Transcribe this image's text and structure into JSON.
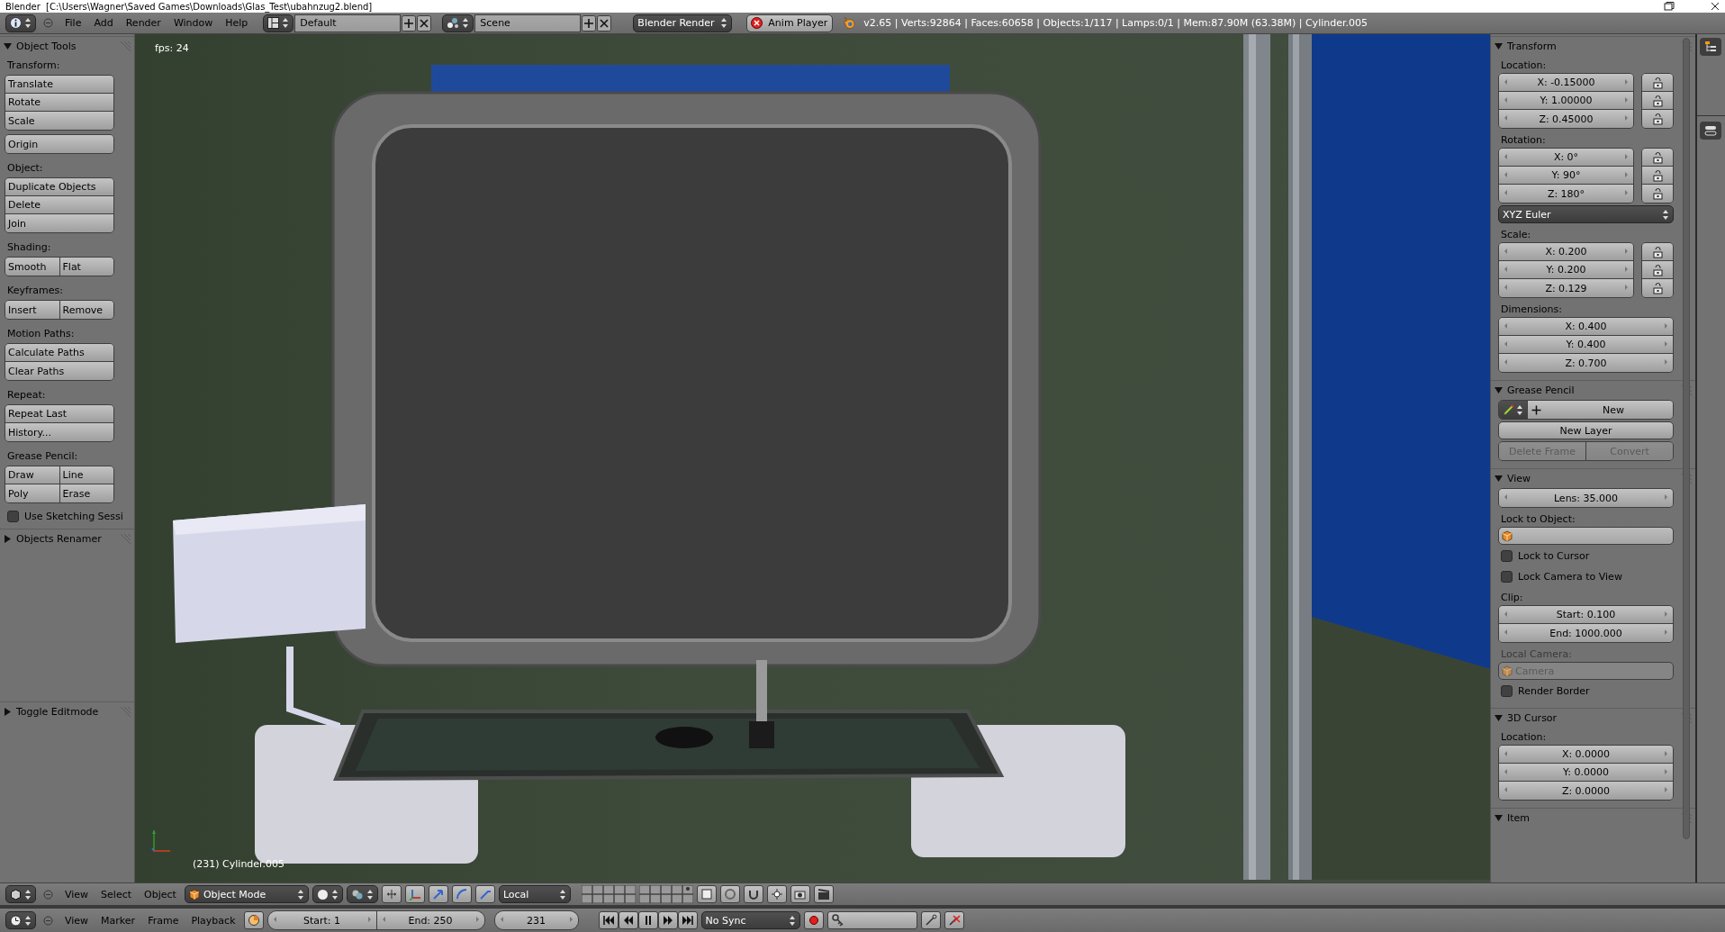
{
  "title_bar": {
    "text": "Blender  [C:\\Users\\Wagner\\Saved Games\\Downloads\\Glas_Test\\ubahnzug2.blend]"
  },
  "info_header": {
    "menus": [
      "File",
      "Add",
      "Render",
      "Window",
      "Help"
    ],
    "layout": "Default",
    "scene": "Scene",
    "engine": "Blender Render",
    "anim_player": "Anim Player",
    "stats": "v2.65 | Verts:92864 | Faces:60658 | Objects:1/117 | Lamps:0/1 | Mem:87.90M (63.38M) | Cylinder.005"
  },
  "tool_shelf": {
    "panels": [
      {
        "title": "Object Tools",
        "expanded": true,
        "sections": [
          {
            "label": "Transform:",
            "groups": [
              [
                [
                  "Translate"
                ],
                [
                  "Rotate"
                ],
                [
                  "Scale"
                ]
              ],
              [
                [
                  "Origin"
                ]
              ]
            ]
          },
          {
            "label": "Object:",
            "groups": [
              [
                [
                  "Duplicate Objects"
                ],
                [
                  "Delete"
                ],
                [
                  "Join"
                ]
              ]
            ]
          },
          {
            "label": "Shading:",
            "groups": [
              [
                [
                  "Smooth",
                  "Flat"
                ]
              ]
            ]
          },
          {
            "label": "Keyframes:",
            "groups": [
              [
                [
                  "Insert",
                  "Remove"
                ]
              ]
            ]
          },
          {
            "label": "Motion Paths:",
            "groups": [
              [
                [
                  "Calculate Paths"
                ],
                [
                  "Clear Paths"
                ]
              ]
            ]
          },
          {
            "label": "Repeat:",
            "groups": [
              [
                [
                  "Repeat Last"
                ],
                [
                  "History..."
                ]
              ]
            ]
          },
          {
            "label": "Grease Pencil:",
            "groups": [
              [
                [
                  "Draw",
                  "Line"
                ],
                [
                  "Poly",
                  "Erase"
                ]
              ]
            ],
            "checkbox": {
              "label": "Use Sketching Sessi",
              "checked": false
            }
          }
        ]
      },
      {
        "title": "Objects Renamer",
        "expanded": false
      },
      {
        "title": "Toggle Editmode",
        "expanded": false
      }
    ]
  },
  "viewport": {
    "fps": "fps: 24",
    "object_info": "(231) Cylinder.005"
  },
  "properties": {
    "panels": [
      {
        "title": "Transform",
        "expanded": true,
        "items": [
          {
            "kind": "label",
            "text": "Location:",
            "disabled": false
          },
          {
            "kind": "fields",
            "items": [
              {
                "text": "X: -0.15000",
                "locked": false
              },
              {
                "text": "Y: 1.00000",
                "locked": false
              },
              {
                "text": "Z: 0.45000",
                "locked": false
              }
            ]
          },
          {
            "kind": "label",
            "text": "Rotation:",
            "disabled": false
          },
          {
            "kind": "fields",
            "items": [
              {
                "text": "X: 0°",
                "locked": false
              },
              {
                "text": "Y: 90°",
                "locked": false
              },
              {
                "text": "Z: 180°",
                "locked": false
              }
            ]
          },
          {
            "kind": "dropdown",
            "text": "XYZ Euler"
          },
          {
            "kind": "label",
            "text": "Scale:",
            "disabled": false
          },
          {
            "kind": "fields",
            "items": [
              {
                "text": "X: 0.200",
                "locked": false
              },
              {
                "text": "Y: 0.200",
                "locked": false
              },
              {
                "text": "Z: 0.129",
                "locked": false
              }
            ]
          },
          {
            "kind": "label",
            "text": "Dimensions:",
            "disabled": false
          },
          {
            "kind": "fields",
            "items": [
              {
                "text": "X: 0.400"
              },
              {
                "text": "Y: 0.400"
              },
              {
                "text": "Z: 0.700"
              }
            ]
          }
        ]
      },
      {
        "title": "Grease Pencil",
        "expanded": true,
        "items": [
          {
            "kind": "gp_new",
            "text": "New"
          },
          {
            "kind": "button",
            "text": "New Layer"
          },
          {
            "kind": "buttons",
            "items": [
              {
                "text": "Delete Frame",
                "disabled": true
              },
              {
                "text": "Convert",
                "disabled": true
              }
            ]
          }
        ]
      },
      {
        "title": "View",
        "expanded": true,
        "items": [
          {
            "kind": "fields",
            "items": [
              {
                "text": "Lens: 35.000"
              }
            ]
          },
          {
            "kind": "label",
            "text": "Lock to Object:",
            "disabled": false
          },
          {
            "kind": "object_field",
            "disabled": false
          },
          {
            "kind": "checkbox",
            "text": "Lock to Cursor",
            "checked": false
          },
          {
            "kind": "checkbox",
            "text": "Lock Camera to View",
            "checked": false
          },
          {
            "kind": "label",
            "text": "Clip:",
            "disabled": false
          },
          {
            "kind": "fields",
            "items": [
              {
                "text": "Start: 0.100"
              },
              {
                "text": "End: 1000.000"
              }
            ]
          },
          {
            "kind": "label",
            "text": "Local Camera:",
            "disabled": true
          },
          {
            "kind": "object_field",
            "text": "Camera",
            "disabled": true
          },
          {
            "kind": "checkbox",
            "text": "Render Border",
            "checked": false
          }
        ]
      },
      {
        "title": "3D Cursor",
        "expanded": true,
        "items": [
          {
            "kind": "label",
            "text": "Location:",
            "disabled": false
          },
          {
            "kind": "fields",
            "items": [
              {
                "text": "X: 0.0000"
              },
              {
                "text": "Y: 0.0000"
              },
              {
                "text": "Z: 0.0000"
              }
            ]
          }
        ]
      },
      {
        "title": "Item",
        "expanded": true
      }
    ]
  },
  "view3d_header": {
    "menus": [
      "View",
      "Select",
      "Object"
    ],
    "mode": "Object Mode",
    "orientation": "Local"
  },
  "timeline_header": {
    "menus": [
      "View",
      "Marker",
      "Frame",
      "Playback"
    ],
    "start": "Start: 1",
    "end": "End: 250",
    "frame": "231",
    "sync": "No Sync"
  }
}
